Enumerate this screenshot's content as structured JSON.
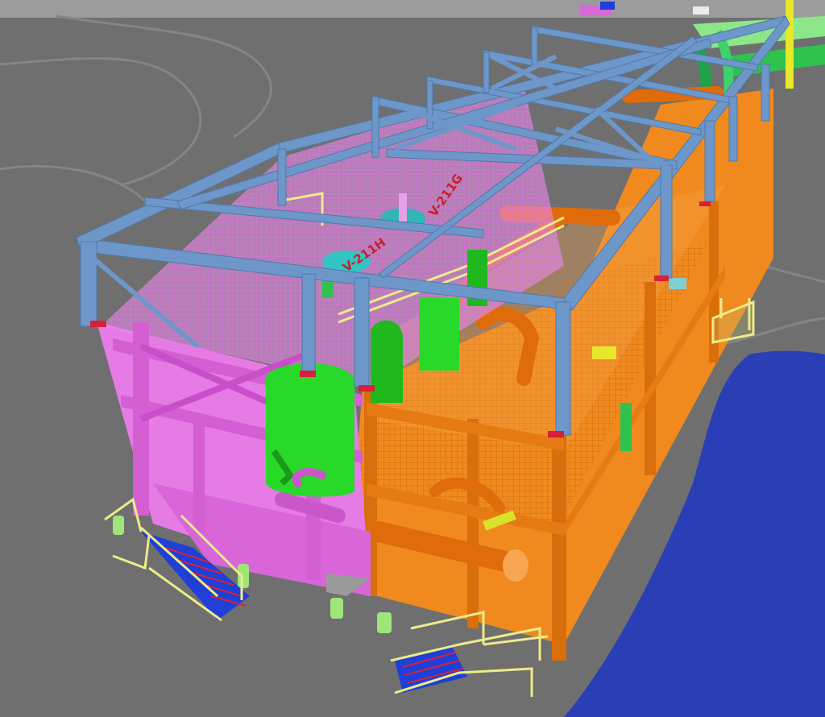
{
  "viewport": {
    "type": "3d-model-view",
    "background_color": "#6f6f6f",
    "ground_lines_color": "#8a8a8a"
  },
  "colors": {
    "steel_frame": "#6e97c9",
    "pink_module": "#e67be6",
    "orange_module": "#f08a1e",
    "green_vessel": "#29d929",
    "pipe_green": "#3fd16a",
    "stair_blue": "#1f3fd6",
    "handrail_yellow": "#ecec8a",
    "water_blue": "#2a3fb6",
    "pedestal_green": "#9fe57a",
    "node_red": "#d8203a"
  },
  "equipment_tags": {
    "tag_1": "V-211H",
    "tag_2": "V-211G"
  }
}
